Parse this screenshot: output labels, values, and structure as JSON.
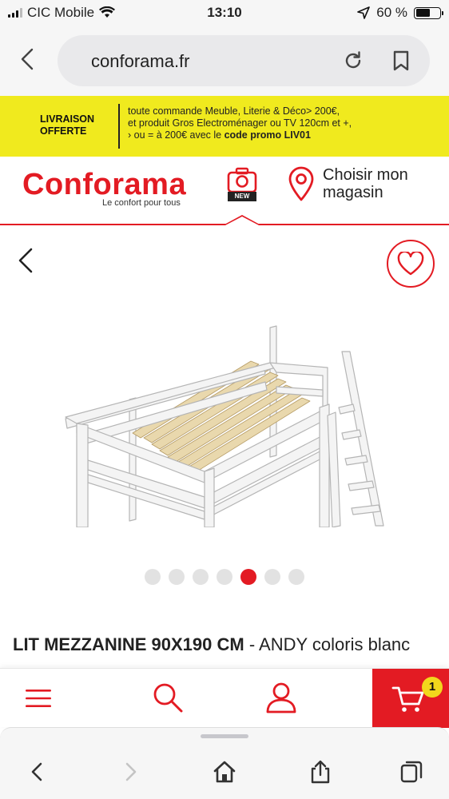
{
  "status_bar": {
    "carrier": "CIC Mobile",
    "time": "13:10",
    "battery_percent": "60 %",
    "battery_level": 0.6
  },
  "browser": {
    "url": "conforama.fr"
  },
  "promo": {
    "title": "LIVRAISON OFFERTE",
    "line1": "toute commande Meuble, Literie & Déco> 200€,",
    "line2": "et produit Gros Electroménager ou TV 120cm et +,",
    "line3_prefix": "› ou = à 200€ avec le ",
    "line3_code": "code promo LIV01"
  },
  "brand": {
    "logo": "Conforama",
    "tagline": "Le confort pour tous",
    "new_badge": "NEW",
    "store_label": "Choisir mon magasin"
  },
  "gallery": {
    "image_count": 7,
    "active_index": 4
  },
  "product": {
    "title_bold": "LIT MEZZANINE 90X190 CM",
    "title_rest": " - ANDY coloris blanc"
  },
  "site_nav": {
    "cart_count": "1"
  },
  "colors": {
    "brand_red": "#e31b23",
    "promo_yellow": "#f0ea1e",
    "badge_yellow": "#f2d81c"
  }
}
